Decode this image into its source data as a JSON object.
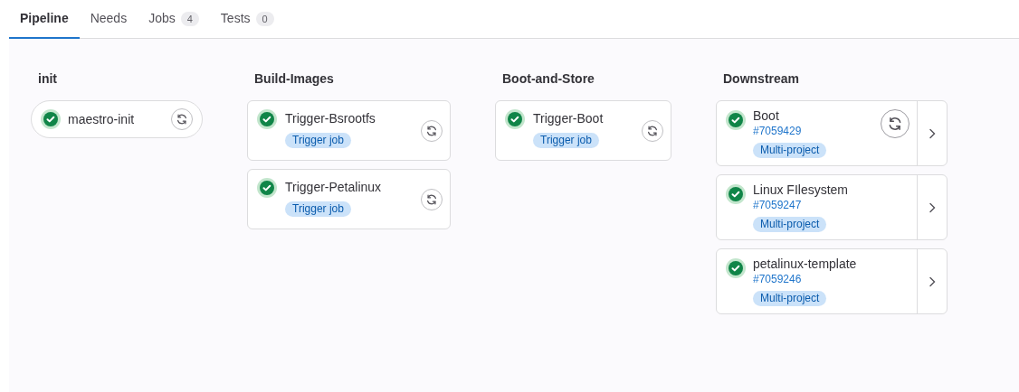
{
  "tabs": [
    {
      "label": "Pipeline",
      "selected": true
    },
    {
      "label": "Needs",
      "selected": false
    },
    {
      "label": "Jobs",
      "count": "4",
      "selected": false
    },
    {
      "label": "Tests",
      "count": "0",
      "selected": false
    }
  ],
  "stages": [
    {
      "title": "init",
      "jobs": [
        {
          "kind": "pill",
          "name": "maestro-init",
          "passed": true
        }
      ]
    },
    {
      "title": "Build-Images",
      "jobs": [
        {
          "kind": "trigger",
          "name": "Trigger-Bsrootfs",
          "passed": true,
          "badge": "Trigger job"
        },
        {
          "kind": "trigger",
          "name": "Trigger-Petalinux",
          "passed": true,
          "badge": "Trigger job"
        }
      ]
    },
    {
      "title": "Boot-and-Store",
      "jobs": [
        {
          "kind": "trigger",
          "name": "Trigger-Boot",
          "passed": true,
          "badge": "Trigger job"
        }
      ]
    },
    {
      "title": "Downstream",
      "jobs": [
        {
          "kind": "downstream",
          "name": "Boot",
          "passed": true,
          "link": "#7059429",
          "badge": "Multi-project",
          "retry": true
        },
        {
          "kind": "downstream",
          "name": "Linux FIlesystem",
          "passed": true,
          "link": "#7059247",
          "badge": "Multi-project",
          "retry": false
        },
        {
          "kind": "downstream",
          "name": "petalinux-template",
          "passed": true,
          "link": "#7059246",
          "badge": "Multi-project",
          "retry": false
        }
      ]
    }
  ]
}
